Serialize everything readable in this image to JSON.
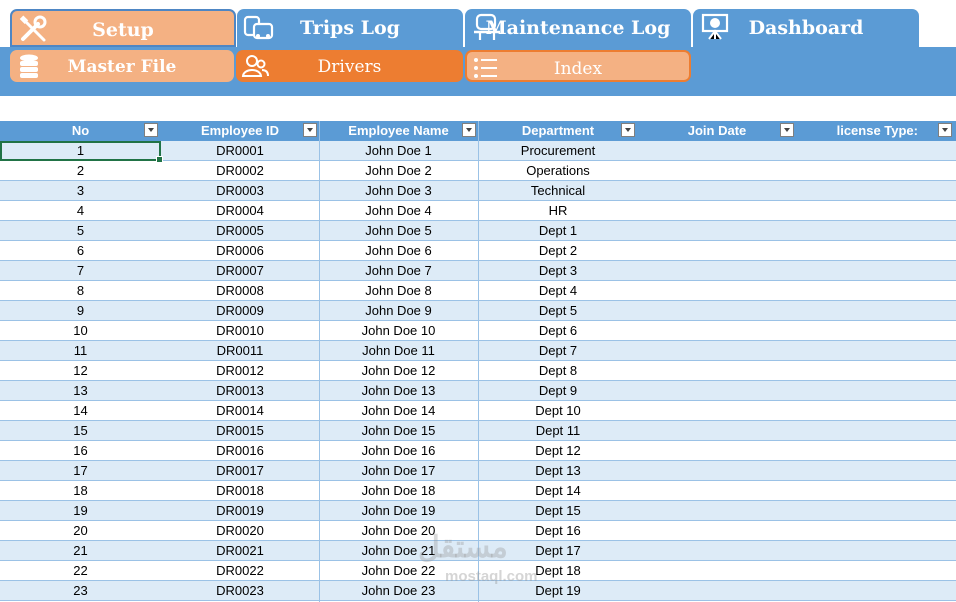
{
  "nav": {
    "tabs": [
      {
        "label": "Setup",
        "icon": "tools-icon"
      },
      {
        "label": "Trips Log",
        "icon": "vehicles-icon"
      },
      {
        "label": "Maintenance Log",
        "icon": "car-lift-icon"
      },
      {
        "label": "Dashboard",
        "icon": "presentation-chart-icon"
      }
    ],
    "subtabs": [
      {
        "label": "Master File",
        "icon": "database-icon"
      },
      {
        "label": "Drivers",
        "icon": "users-icon"
      },
      {
        "label": "Index",
        "icon": "list-icon"
      }
    ]
  },
  "colors": {
    "blue": "#5B9BD5",
    "orange": "#ED7D31",
    "light_orange": "#F4B183",
    "row_band": "#DDEBF7"
  },
  "table": {
    "columns": [
      "No",
      "Employee ID",
      "Employee Name",
      "Department",
      "Join Date",
      "license Type:"
    ],
    "rows": [
      {
        "no": "1",
        "id": "DR0001",
        "name": "John Doe 1",
        "dept": "Procurement"
      },
      {
        "no": "2",
        "id": "DR0002",
        "name": "John Doe 2",
        "dept": "Operations"
      },
      {
        "no": "3",
        "id": "DR0003",
        "name": "John Doe 3",
        "dept": "Technical"
      },
      {
        "no": "4",
        "id": "DR0004",
        "name": "John Doe 4",
        "dept": "HR"
      },
      {
        "no": "5",
        "id": "DR0005",
        "name": "John Doe 5",
        "dept": "Dept 1"
      },
      {
        "no": "6",
        "id": "DR0006",
        "name": "John Doe 6",
        "dept": "Dept 2"
      },
      {
        "no": "7",
        "id": "DR0007",
        "name": "John Doe 7",
        "dept": "Dept 3"
      },
      {
        "no": "8",
        "id": "DR0008",
        "name": "John Doe 8",
        "dept": "Dept 4"
      },
      {
        "no": "9",
        "id": "DR0009",
        "name": "John Doe 9",
        "dept": "Dept 5"
      },
      {
        "no": "10",
        "id": "DR0010",
        "name": "John Doe 10",
        "dept": "Dept 6"
      },
      {
        "no": "11",
        "id": "DR0011",
        "name": "John Doe 11",
        "dept": "Dept 7"
      },
      {
        "no": "12",
        "id": "DR0012",
        "name": "John Doe 12",
        "dept": "Dept 8"
      },
      {
        "no": "13",
        "id": "DR0013",
        "name": "John Doe 13",
        "dept": "Dept 9"
      },
      {
        "no": "14",
        "id": "DR0014",
        "name": "John Doe 14",
        "dept": "Dept 10"
      },
      {
        "no": "15",
        "id": "DR0015",
        "name": "John Doe 15",
        "dept": "Dept 11"
      },
      {
        "no": "16",
        "id": "DR0016",
        "name": "John Doe 16",
        "dept": "Dept 12"
      },
      {
        "no": "17",
        "id": "DR0017",
        "name": "John Doe 17",
        "dept": "Dept 13"
      },
      {
        "no": "18",
        "id": "DR0018",
        "name": "John Doe 18",
        "dept": "Dept 14"
      },
      {
        "no": "19",
        "id": "DR0019",
        "name": "John Doe 19",
        "dept": "Dept 15"
      },
      {
        "no": "20",
        "id": "DR0020",
        "name": "John Doe 20",
        "dept": "Dept 16"
      },
      {
        "no": "21",
        "id": "DR0021",
        "name": "John Doe 21",
        "dept": "Dept 17"
      },
      {
        "no": "22",
        "id": "DR0022",
        "name": "John Doe 22",
        "dept": "Dept 18"
      },
      {
        "no": "23",
        "id": "DR0023",
        "name": "John Doe 23",
        "dept": "Dept 19"
      }
    ]
  },
  "watermark": {
    "text": "مستقل",
    "subtext": "mostaql.com"
  }
}
